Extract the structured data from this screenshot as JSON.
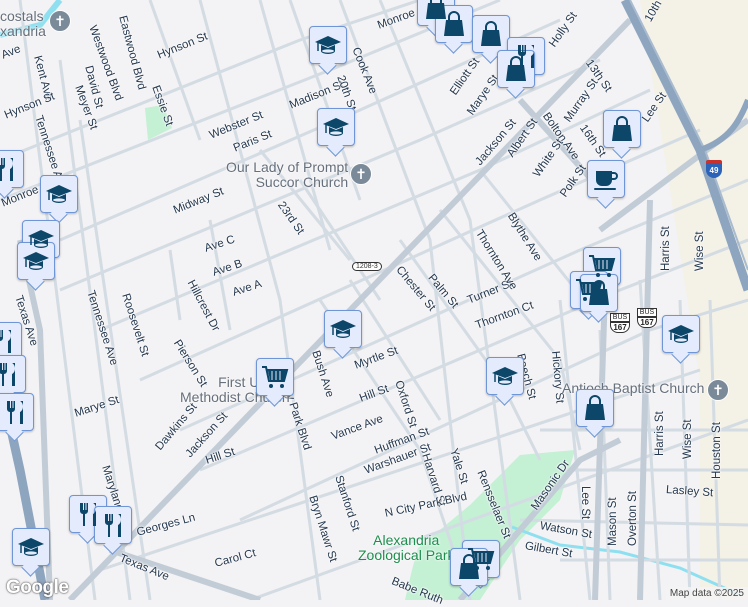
{
  "colors": {
    "background": "#f3f2f4",
    "road": "#d3dbe3",
    "highway": "#8ea5bf",
    "park": "#c4f0d4",
    "pin_fill": "#e3ebfc",
    "pin_border": "#6e96d6",
    "icon": "#0c4668"
  },
  "streets": [
    "Kent Ave",
    "Westwood Blvd",
    "Eastwood Blvd",
    "Hynson St",
    "Essie St",
    "David St",
    "Meyer St",
    "Hynson St",
    "Tennessee Ave",
    "Monroe St",
    "Webster St",
    "Madison St",
    "Paris St",
    "20th St",
    "Cook Ave",
    "Midway St",
    "23rd St",
    "Ave C",
    "Ave B",
    "Ave A",
    "Hillcrest Dr",
    "Roosevelt St",
    "Texas Ave",
    "Pierson St",
    "Tennessee Ave",
    "Marye St",
    "Dawkins St",
    "Jackson St",
    "Hill St",
    "Maryland Ave",
    "Georges Ln",
    "Texas Ave",
    "Carol Ct",
    "City Park Blvd",
    "Bush Ave",
    "Myrtle St",
    "Hill St",
    "Vance Ave",
    "Stanford St",
    "Bryn Mawr St",
    "Warshauer St",
    "Huffman St",
    "Oxford St",
    "Harvard St",
    "Yale St",
    "Rensselaer St",
    "N City Park Blvd",
    "Chester St",
    "Palm St",
    "Turner St",
    "Thornton Ct",
    "Thornton Ave",
    "Blythe Ave",
    "Beech St",
    "Hickory St",
    "Masonic Dr",
    "Lee St",
    "Mason St",
    "Overton St",
    "Harris St",
    "Wise St",
    "Houston St",
    "Lasley St",
    "Watson St",
    "Gilbert St",
    "Babe Ruth",
    "Jackson St",
    "Bolton Ave",
    "Albert St",
    "White St",
    "Polk St",
    "Murray St",
    "16th St",
    "13th St",
    "Holly St",
    "Elliott St",
    "Marye St",
    "Lee St",
    "10th St",
    "Harris St",
    "Wise St",
    "Monroe St",
    "Ave"
  ],
  "places": {
    "church_top": "costals\nxandria",
    "our_lady": "Our Lady of Prompt\nSuccor Church",
    "first_united": "First United\nMethodist Church",
    "antioch": "Antioch Baptist Church",
    "zoo": "Alexandria\nZoological Park"
  },
  "shields": {
    "route_1208": "1208-3",
    "bus": "BUS",
    "us167": "167",
    "i49": "49"
  },
  "markers": [
    "school",
    "school",
    "school",
    "school",
    "school",
    "school",
    "school",
    "school",
    "school",
    "shopping",
    "shopping",
    "shopping",
    "shopping",
    "shopping",
    "shopping",
    "shopping",
    "shopping",
    "restaurant",
    "restaurant",
    "restaurant",
    "restaurant",
    "grocery",
    "grocery",
    "grocery",
    "cafe"
  ],
  "footer": {
    "logo": "Google",
    "attribution": "Map data ©2025"
  }
}
